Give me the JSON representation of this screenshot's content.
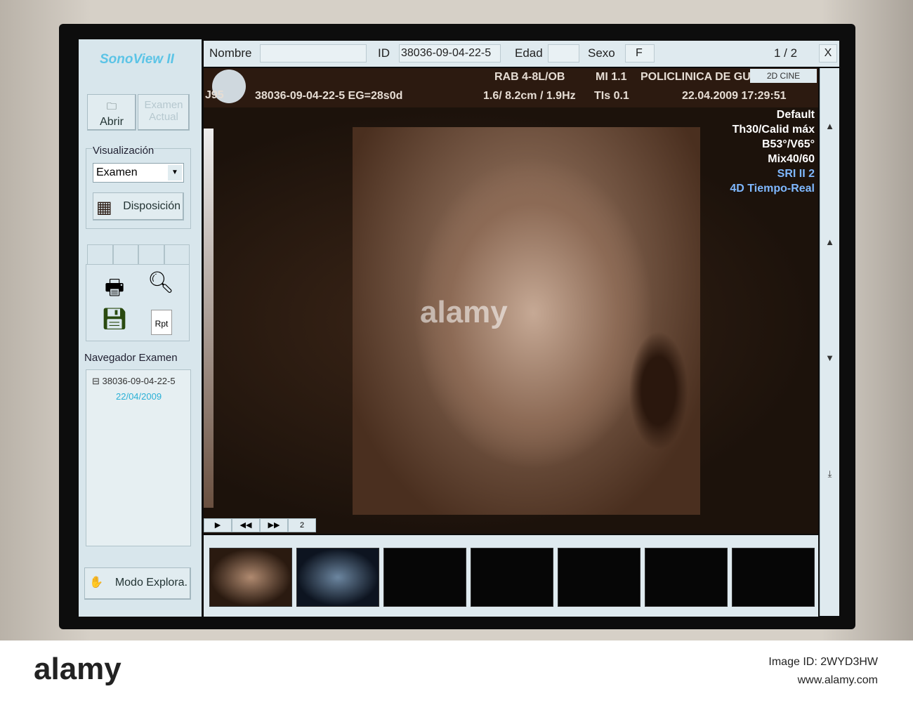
{
  "app": {
    "logo": "SonoView II"
  },
  "sidebar": {
    "open_label": "Abrir",
    "current_exam_label": "Examen Actual",
    "visualization_heading": "Visualización",
    "visualization_select": "Examen",
    "layout_button": "Disposición",
    "report_icon_text": "Rpt",
    "navigator_heading": "Navegador Examen",
    "navigator_items": [
      {
        "id": "38036-09-04-22-5",
        "date": "22/04/2009"
      }
    ],
    "mode_button": "Modo Explora."
  },
  "patient": {
    "name_label": "Nombre",
    "name_value": "",
    "id_label": "ID",
    "id_value": "38036-09-04-22-5",
    "age_label": "Edad",
    "age_value": "",
    "sex_label": "Sexo",
    "sex_value": "F",
    "page": "1 / 2",
    "close": "X"
  },
  "info": {
    "corner": "J95",
    "probe": "RAB 4-8L/OB",
    "mi": "MI  1.1",
    "clinic": "POLICLINICA DE GUI",
    "mode_tab": "2D CINE",
    "exam_id": "38036-09-04-22-5  EG=28s0d",
    "depth": "1.6/ 8.2cm / 1.9Hz",
    "tis": "TIs  0.1",
    "datetime": "22.04.2009  17:29:51"
  },
  "overlay": [
    "Default",
    "Th30/Calid máx",
    "B53°/V65°",
    "Mix40/60",
    "SRI II 2",
    "4D Tiempo-Real"
  ],
  "overlay_colors": {
    "default": "#ffffff",
    "sri": "#7fb8ff"
  },
  "cine": {
    "frame": "2"
  },
  "watermark": {
    "brand": "alamy",
    "image_id": "Image ID: 2WYD3HW",
    "url": "www.alamy.com"
  }
}
